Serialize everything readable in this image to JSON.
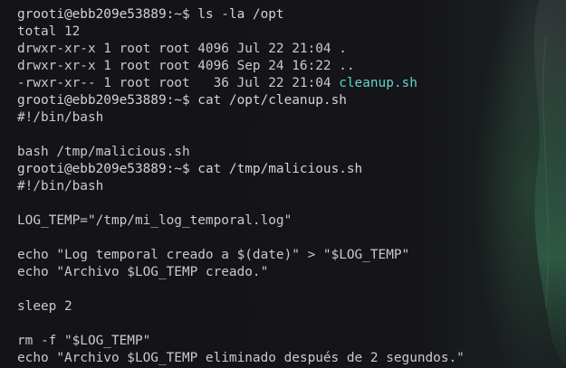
{
  "colors": {
    "background": "#141318",
    "text": "#c9c9d3",
    "executable": "#5fd7c8",
    "leaf_green": "#2f5a45"
  },
  "session": [
    {
      "type": "prompt",
      "prompt": "grooti@ebb209e53889:~$ ",
      "command": "ls -la /opt"
    },
    {
      "type": "output",
      "text": "total 12"
    },
    {
      "type": "output",
      "text": "drwxr-xr-x 1 root root 4096 Jul 22 21:04 ."
    },
    {
      "type": "output",
      "text": "drwxr-xr-x 1 root root 4096 Sep 24 16:22 .."
    },
    {
      "type": "ls_exec",
      "meta": "-rwxr-xr-- 1 root root   36 Jul 22 21:04 ",
      "name": "cleanup.sh"
    },
    {
      "type": "prompt",
      "prompt": "grooti@ebb209e53889:~$ ",
      "command": "cat /opt/cleanup.sh"
    },
    {
      "type": "output",
      "text": "#!/bin/bash"
    },
    {
      "type": "output",
      "text": ""
    },
    {
      "type": "output",
      "text": "bash /tmp/malicious.sh"
    },
    {
      "type": "prompt",
      "prompt": "grooti@ebb209e53889:~$ ",
      "command": "cat /tmp/malicious.sh"
    },
    {
      "type": "output",
      "text": "#!/bin/bash"
    },
    {
      "type": "output",
      "text": ""
    },
    {
      "type": "output",
      "text": "LOG_TEMP=\"/tmp/mi_log_temporal.log\""
    },
    {
      "type": "output",
      "text": ""
    },
    {
      "type": "output",
      "text": "echo \"Log temporal creado a $(date)\" > \"$LOG_TEMP\""
    },
    {
      "type": "output",
      "text": "echo \"Archivo $LOG_TEMP creado.\""
    },
    {
      "type": "output",
      "text": ""
    },
    {
      "type": "output",
      "text": "sleep 2"
    },
    {
      "type": "output",
      "text": ""
    },
    {
      "type": "output",
      "text": "rm -f \"$LOG_TEMP\""
    },
    {
      "type": "output",
      "text": "echo \"Archivo $LOG_TEMP eliminado después de 2 segundos.\""
    }
  ]
}
